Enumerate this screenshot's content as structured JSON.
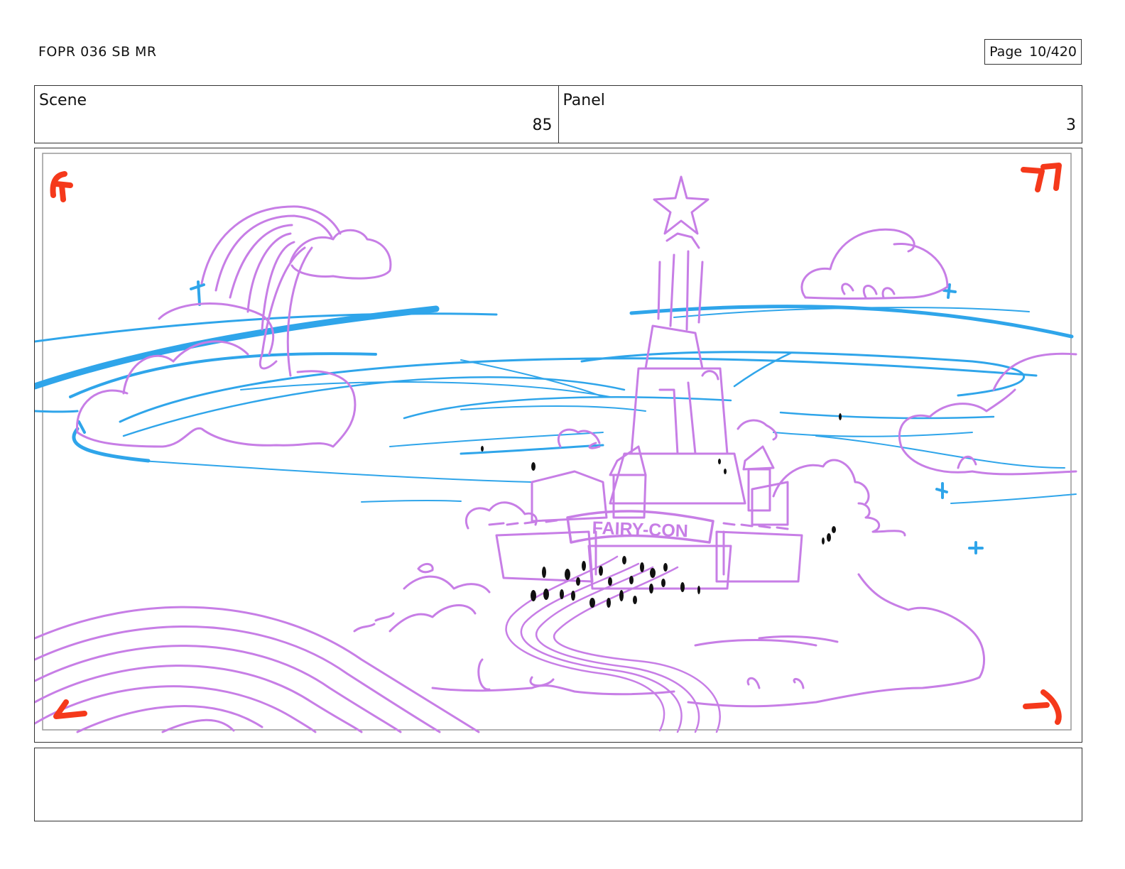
{
  "header": {
    "doc_title": "FOPR 036 SB MR",
    "page_label": "Page",
    "page_value": "10/420"
  },
  "info": {
    "scene_label": "Scene",
    "scene_value": "85",
    "panel_label": "Panel",
    "panel_value": "3"
  },
  "drawing": {
    "banner_text": "FAIRY-CON",
    "colors": {
      "sketch": "#c77ee6",
      "wind": "#2fa5ea",
      "corner_marks": "#f5391b",
      "crowd": "#111111"
    }
  },
  "notes": {
    "text": ""
  }
}
